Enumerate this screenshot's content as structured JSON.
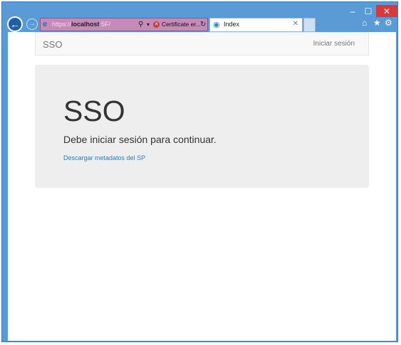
{
  "browser": {
    "address": {
      "scheme": "https://",
      "host": "localhost",
      "path": ":5F/",
      "cert_error": "Certificate er..."
    },
    "tab": {
      "label": "Index"
    },
    "window_controls": {
      "minimize": "–",
      "maximize": "☐",
      "close": "✕"
    },
    "icons": {
      "back": "←",
      "forward": "→",
      "home": "⌂",
      "favorites": "★",
      "settings": "⚙"
    }
  },
  "navbar": {
    "brand": "SSO",
    "login_label": "Iniciar sesión"
  },
  "jumbotron": {
    "title": "SSO",
    "lead": "Debe iniciar sesión para continuar.",
    "link": "Descargar metadatos del SP"
  },
  "colors": {
    "frame": "#5b9bd5",
    "address_bar": "#c58ab8",
    "close_button": "#d9393b",
    "link": "#337ab7",
    "jumbotron_bg": "#eeeeee"
  }
}
